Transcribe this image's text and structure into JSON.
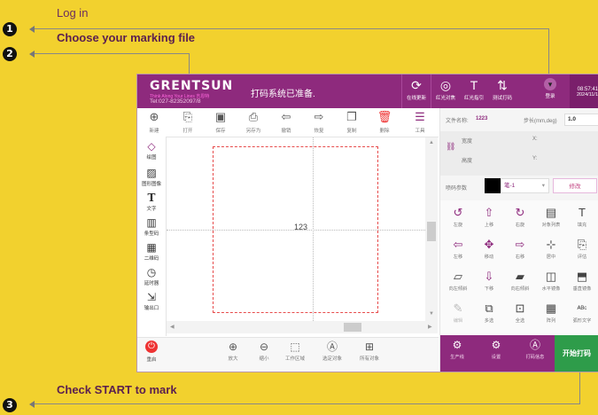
{
  "annotations": {
    "login_text": "Log in",
    "choose_file_text": "Choose your marking file",
    "check_start_text": "Check START to mark",
    "step_numbers": [
      "1",
      "2",
      "3"
    ]
  },
  "app": {
    "logo": "GRENTSUN",
    "logo_sub": "Think Along Your Lines 吉恩特",
    "logo_tel": "Tel:027-82352097/8",
    "status": "打码系统已准备.",
    "titlebar_buttons": [
      {
        "icon": "refresh-icon",
        "label": "在线更新"
      },
      {
        "icon": "target-icon",
        "label": "红光对焦"
      },
      {
        "icon": "text-icon",
        "label": "红光指引"
      },
      {
        "icon": "test-print-icon",
        "label": "测试打码"
      },
      {
        "icon": "login-icon",
        "label": "登录"
      }
    ],
    "clock_time": "08:57:41",
    "clock_date": "2024/11/1",
    "toolbar": [
      {
        "icon": "new-icon",
        "label": "新建"
      },
      {
        "icon": "open-icon",
        "label": "打开"
      },
      {
        "icon": "save-icon",
        "label": "保存"
      },
      {
        "icon": "save-as-icon",
        "label": "另存为"
      },
      {
        "icon": "undo-icon",
        "label": "撤销"
      },
      {
        "icon": "redo-icon",
        "label": "恢复"
      },
      {
        "icon": "copy-icon",
        "label": "复制"
      },
      {
        "icon": "delete-icon",
        "label": "删除"
      },
      {
        "icon": "tools-icon",
        "label": "工具"
      }
    ],
    "left_tools": [
      {
        "icon": "draw-icon",
        "label": "绘图"
      },
      {
        "icon": "image-icon",
        "label": "图形图像"
      },
      {
        "icon": "text-tool-icon",
        "label": "文字"
      },
      {
        "icon": "barcode-icon",
        "label": "条型码"
      },
      {
        "icon": "qrcode-icon",
        "label": "二维码"
      },
      {
        "icon": "timer-icon",
        "label": "延时器"
      },
      {
        "icon": "output-icon",
        "label": "输出口"
      }
    ],
    "canvas_text": "123",
    "restart_label": "重启",
    "bottom_tools": [
      {
        "icon": "zoom-in-icon",
        "label": "放大"
      },
      {
        "icon": "zoom-out-icon",
        "label": "缩小"
      },
      {
        "icon": "work-area-icon",
        "label": "工作区域"
      },
      {
        "icon": "select-object-icon",
        "label": "选定对象"
      },
      {
        "icon": "all-objects-icon",
        "label": "所有对象"
      }
    ],
    "right": {
      "file_name_label": "文件名称:",
      "file_name_value": "1223",
      "step_label": "步长(mm,deg)",
      "step_value": "1.0",
      "width_label": "宽度",
      "height_label": "高度",
      "x_label": "X:",
      "y_label": "Y:",
      "pen_param_label": "喷码参数",
      "pen_value": "笔-1",
      "modify_label": "修改",
      "grid": [
        {
          "icon": "rotate-left-icon",
          "label": "左旋"
        },
        {
          "icon": "move-up-icon",
          "label": "上移"
        },
        {
          "icon": "rotate-right-icon",
          "label": "右旋"
        },
        {
          "icon": "object-list-icon",
          "label": "对象列表"
        },
        {
          "icon": "fill-icon",
          "label": "填充"
        },
        {
          "icon": "move-left-icon",
          "label": "左移"
        },
        {
          "icon": "move-icon",
          "label": "移动"
        },
        {
          "icon": "move-right-icon",
          "label": "右移"
        },
        {
          "icon": "center-icon",
          "label": "居中"
        },
        {
          "icon": "evaluate-icon",
          "label": "评估"
        },
        {
          "icon": "skew-left-icon",
          "label": "向左倾斜"
        },
        {
          "icon": "move-down-icon",
          "label": "下移"
        },
        {
          "icon": "skew-right-icon",
          "label": "向右倾斜"
        },
        {
          "icon": "mirror-h-icon",
          "label": "水平镜像"
        },
        {
          "icon": "mirror-v-icon",
          "label": "垂直镜像"
        },
        {
          "icon": "edit-icon",
          "label": "编辑"
        },
        {
          "icon": "multi-select-icon",
          "label": "多选"
        },
        {
          "icon": "select-all-icon",
          "label": "全选"
        },
        {
          "icon": "array-icon",
          "label": "阵列"
        },
        {
          "icon": "arc-text-icon",
          "label": "弧形文字"
        }
      ],
      "bottom": [
        {
          "icon": "production-line-icon",
          "label": "生产线"
        },
        {
          "icon": "settings-icon",
          "label": "设置"
        },
        {
          "icon": "print-info-icon",
          "label": "打码信息"
        }
      ],
      "start_label": "开始打码"
    }
  },
  "colors": {
    "background": "#f2d12e",
    "brand": "#8e2a7d",
    "start": "#2e9c4a",
    "annotation_text": "#5a1f4f"
  }
}
